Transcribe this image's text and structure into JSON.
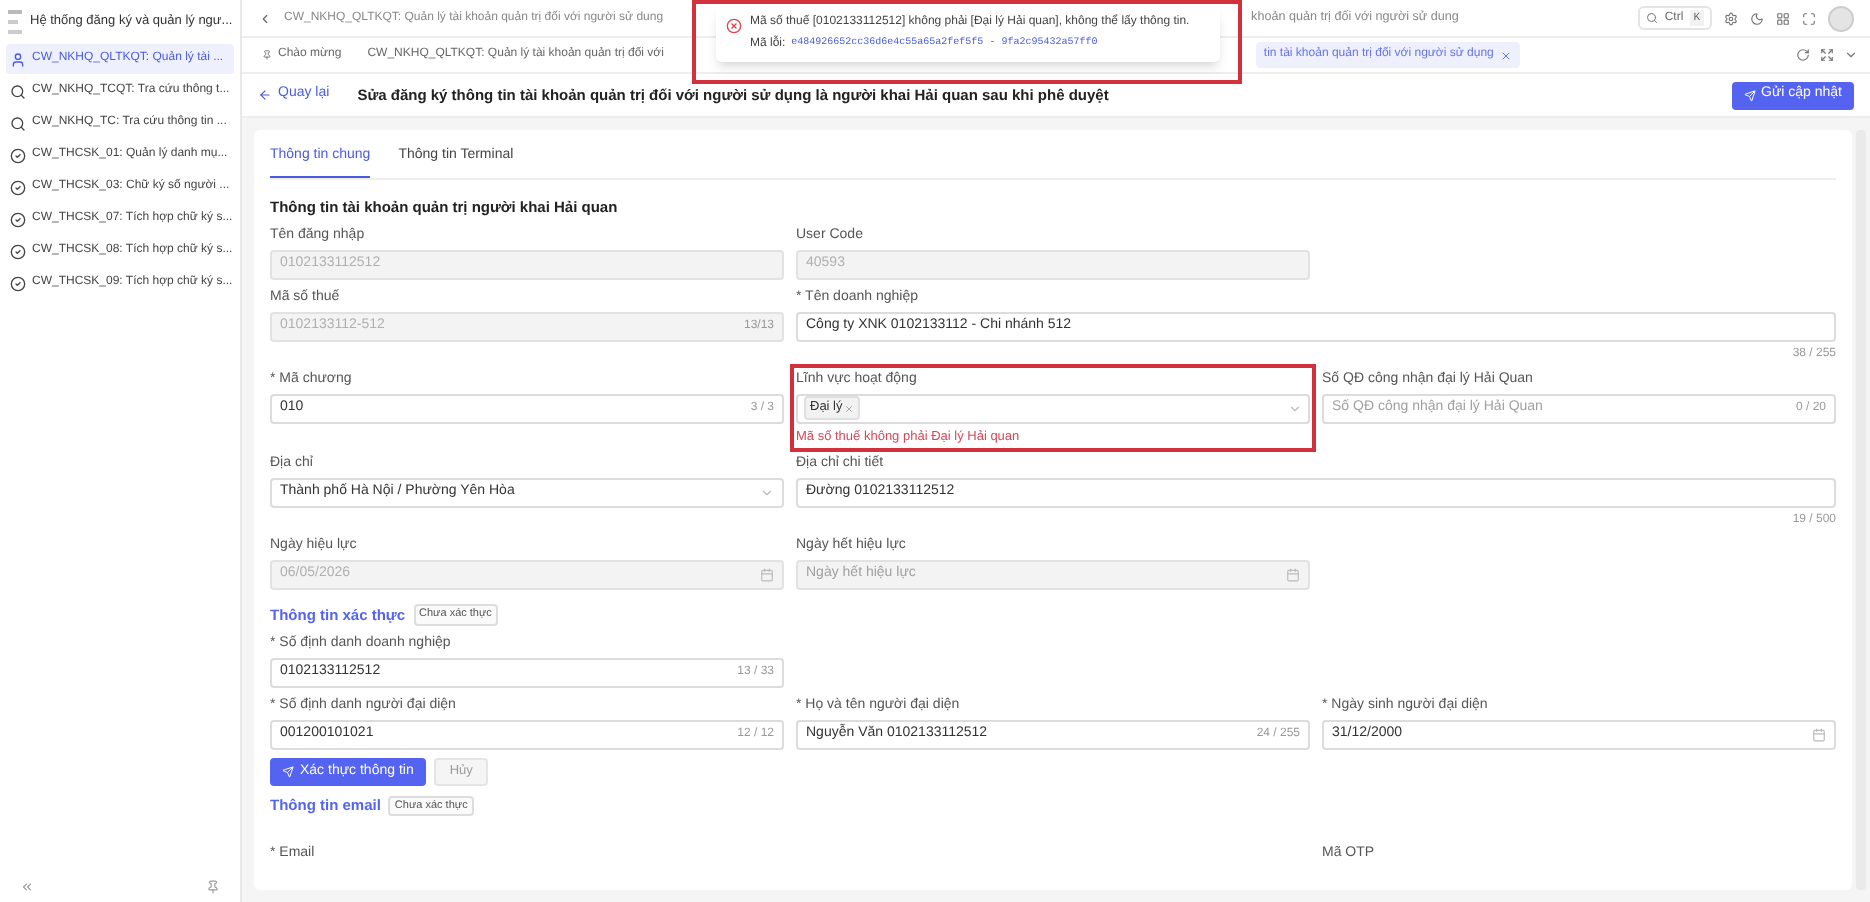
{
  "sidebar": {
    "title": "Hệ thống đăng ký và quản lý ngư...",
    "items": [
      {
        "label": "CW_NKHQ_QLTKQT: Quản lý tài ...",
        "kind": "user",
        "selected": true
      },
      {
        "label": "CW_NKHQ_TCQT: Tra cứu thông t...",
        "kind": "search",
        "selected": false
      },
      {
        "label": "CW_NKHQ_TC: Tra cứu thông tin ...",
        "kind": "search",
        "selected": false
      },
      {
        "label": "CW_THCSK_01: Quản lý danh mụ...",
        "kind": "check",
        "selected": false
      },
      {
        "label": "CW_THCSK_03: Chữ ký số người ...",
        "kind": "check",
        "selected": false
      },
      {
        "label": "CW_THCSK_07: Tích hợp chữ ký s...",
        "kind": "check",
        "selected": false
      },
      {
        "label": "CW_THCSK_08: Tích hợp chữ ký s...",
        "kind": "check",
        "selected": false
      },
      {
        "label": "CW_THCSK_09: Tích hợp chữ ký s...",
        "kind": "check",
        "selected": false
      }
    ]
  },
  "top_bar": {
    "breadcrumb_1": "CW_NKHQ_QLTKQT: Quản lý tài khoản quản trị đối với người sử dung",
    "breadcrumb_2": "khoản quản trị đối với người sử dung",
    "search": {
      "label": "Ctrl",
      "key": "K"
    }
  },
  "page_tabs": [
    {
      "label": "Chào mừng",
      "selected": false,
      "closable": false
    },
    {
      "label": "CW_NKHQ_QLTKQT: Quản lý tài khoản quản trị đối với",
      "selected": false,
      "closable": false
    },
    {
      "label": "tin tài khoản quản trị đối với người sử dụng",
      "selected": true,
      "closable": true
    }
  ],
  "toast": {
    "message": "Mã số thuế [0102133112512] không phải [Đại lý Hải quan], không thể lấy thông tin.",
    "code_label": "Mã lỗi:",
    "code": "e484926652cc36d6e4c55a65a2fef5f5 - 9fa2c95432a57ff0",
    "highlighted": true
  },
  "header": {
    "back": "Quay lại",
    "title": "Sửa đăng ký thông tin tài khoản quản trị đối với người sử dụng là người khai Hải quan sau khi phê duyệt",
    "submit": "Gửi cập nhật"
  },
  "form_tabs": [
    {
      "label": "Thông tin chung",
      "selected": true
    },
    {
      "label": "Thông tin Terminal",
      "selected": false
    }
  ],
  "section_title": "Thông tin tài khoản quản trị người khai Hải quan",
  "field_rows": [
    [
      {
        "label": "Tên đăng nhập",
        "kind": "input",
        "value": "0102133112512",
        "disabled": true
      },
      {
        "label": "User Code",
        "kind": "input",
        "value": "40593",
        "disabled": true
      }
    ],
    [
      {
        "label": "Mã số thuế",
        "kind": "input",
        "value": "0102133112-512",
        "counter": "13/13",
        "disabled": true
      },
      {
        "label": "* Tên doanh nghiệp",
        "kind": "textarea",
        "value": "Công ty XNK 0102133112 - Chi nhánh 512",
        "counter": "38 / 255",
        "disabled": false
      }
    ],
    [
      {
        "label": "* Mã chương",
        "kind": "input",
        "value": "010",
        "counter": "3 / 3",
        "disabled": false
      },
      {
        "label": "Lĩnh vực hoạt động",
        "kind": "tags",
        "tags": [
          "Đại lý"
        ],
        "error": "Mã số thuế không phải Đại lý Hải quan",
        "disabled": false,
        "highlighted": true
      },
      {
        "label": "Số QĐ công nhận đại lý Hải Quan",
        "kind": "input",
        "placeholder": "Số QĐ công nhận đại lý Hải Quan",
        "counter": "0 / 20",
        "disabled": false
      }
    ],
    [
      {
        "label": "Địa chỉ",
        "kind": "select",
        "value": "Thành phố Hà Nội / Phường Yên Hòa",
        "disabled": false
      },
      {
        "label": "Địa chỉ chi tiết",
        "kind": "textarea",
        "value": "Đường 0102133112512",
        "counter": "19 / 500",
        "disabled": false
      }
    ],
    [
      {
        "label": "Ngày hiệu lực",
        "kind": "date",
        "value": "06/05/2026",
        "disabled": true
      },
      {
        "label": "Ngày hết hiệu lực",
        "kind": "date",
        "placeholder": "Ngày hết hiệu lực",
        "disabled": true
      }
    ]
  ],
  "verify": {
    "title": "Thông tin xác thực",
    "status": "Chưa xác thực",
    "field_rows": [
      [
        {
          "label": "* Số định danh doanh nghiệp",
          "kind": "input",
          "value": "0102133112512",
          "counter": "13 / 33",
          "disabled": false
        }
      ],
      [
        {
          "label": "* Số định danh người đại diện",
          "kind": "input",
          "value": "001200101021",
          "counter": "12 / 12",
          "disabled": false
        },
        {
          "label": "* Họ và tên người đại diện",
          "kind": "input",
          "value": "Nguyễn Văn 0102133112512",
          "counter": "24 / 255",
          "disabled": false
        },
        {
          "label": "* Ngày sinh người đại diện",
          "kind": "date",
          "value": "31/12/2000",
          "disabled": false
        }
      ]
    ],
    "confirm": "Xác thực thông tin",
    "cancel": {
      "label": "Hủy",
      "disabled": true
    }
  },
  "email": {
    "title": "Thông tin email",
    "status": "Chưa xác thực",
    "email_label": "* Email",
    "otp_label": "Mã OTP"
  }
}
